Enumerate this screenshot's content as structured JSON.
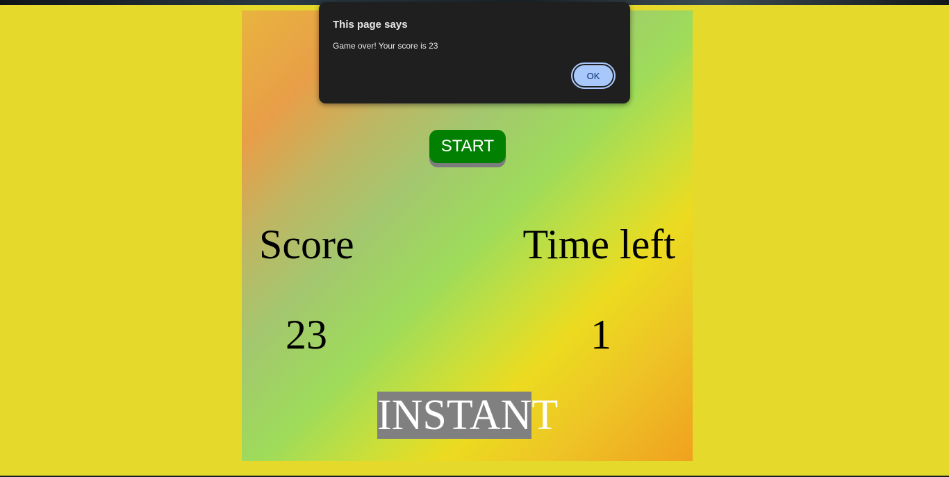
{
  "colors": {
    "page_background": "#e5da2b",
    "start_button": "#018001",
    "typed_highlight": "#808080",
    "dialog_background": "#1f1f1f",
    "ok_button": "#a8c7fa"
  },
  "game": {
    "start_label": "START",
    "score_label": "Score",
    "time_label": "Time left",
    "score_value": "23",
    "time_value": "1",
    "word_typed": "INSTAN",
    "word_remaining": "T"
  },
  "dialog": {
    "title": "This page says",
    "message": "Game over! Your score is 23",
    "ok_label": "OK"
  }
}
